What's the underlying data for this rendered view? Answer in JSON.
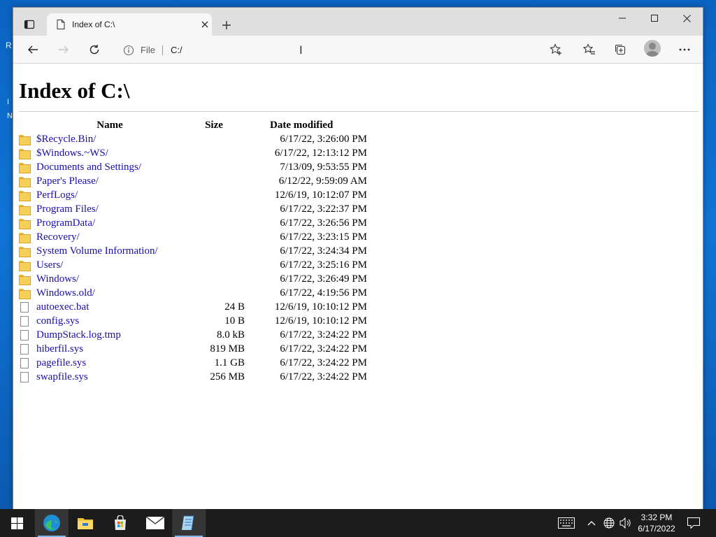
{
  "desktop": {
    "fragment": "R",
    "fragment2": "I",
    "fragment3": "N"
  },
  "browser": {
    "tab_title": "Index of C:\\",
    "address_scheme": "File",
    "address_url": "C:/"
  },
  "page": {
    "heading": "Index of C:\\",
    "columns": {
      "name": "Name",
      "size": "Size",
      "date": "Date modified"
    },
    "entries": [
      {
        "type": "folder",
        "name": "$Recycle.Bin/",
        "size": "",
        "date": "6/17/22, 3:26:00 PM"
      },
      {
        "type": "folder",
        "name": "$Windows.~WS/",
        "size": "",
        "date": "6/17/22, 12:13:12 PM"
      },
      {
        "type": "folder",
        "name": "Documents and Settings/",
        "size": "",
        "date": "7/13/09, 9:53:55 PM"
      },
      {
        "type": "folder",
        "name": "Paper's Please/",
        "size": "",
        "date": "6/12/22, 9:59:09 AM"
      },
      {
        "type": "folder",
        "name": "PerfLogs/",
        "size": "",
        "date": "12/6/19, 10:12:07 PM"
      },
      {
        "type": "folder",
        "name": "Program Files/",
        "size": "",
        "date": "6/17/22, 3:22:37 PM"
      },
      {
        "type": "folder",
        "name": "ProgramData/",
        "size": "",
        "date": "6/17/22, 3:26:56 PM"
      },
      {
        "type": "folder",
        "name": "Recovery/",
        "size": "",
        "date": "6/17/22, 3:23:15 PM"
      },
      {
        "type": "folder",
        "name": "System Volume Information/",
        "size": "",
        "date": "6/17/22, 3:24:34 PM"
      },
      {
        "type": "folder",
        "name": "Users/",
        "size": "",
        "date": "6/17/22, 3:25:16 PM"
      },
      {
        "type": "folder",
        "name": "Windows/",
        "size": "",
        "date": "6/17/22, 3:26:49 PM"
      },
      {
        "type": "folder",
        "name": "Windows.old/",
        "size": "",
        "date": "6/17/22, 4:19:56 PM"
      },
      {
        "type": "file",
        "name": "autoexec.bat",
        "size": "24 B",
        "date": "12/6/19, 10:10:12 PM"
      },
      {
        "type": "file",
        "name": "config.sys",
        "size": "10 B",
        "date": "12/6/19, 10:10:12 PM"
      },
      {
        "type": "file",
        "name": "DumpStack.log.tmp",
        "size": "8.0 kB",
        "date": "6/17/22, 3:24:22 PM"
      },
      {
        "type": "file",
        "name": "hiberfil.sys",
        "size": "819 MB",
        "date": "6/17/22, 3:24:22 PM"
      },
      {
        "type": "file",
        "name": "pagefile.sys",
        "size": "1.1 GB",
        "date": "6/17/22, 3:24:22 PM"
      },
      {
        "type": "file",
        "name": "swapfile.sys",
        "size": "256 MB",
        "date": "6/17/22, 3:24:22 PM"
      }
    ]
  },
  "taskbar": {
    "apps": [
      "edge-icon",
      "file-explorer-icon",
      "store-icon",
      "mail-icon",
      "notepad-icon"
    ],
    "time": "3:32 PM",
    "date": "6/17/2022"
  },
  "colors": {
    "link": "#1a0dab",
    "taskbar": "#1c1c1c",
    "accent": "#7fb9f0"
  }
}
